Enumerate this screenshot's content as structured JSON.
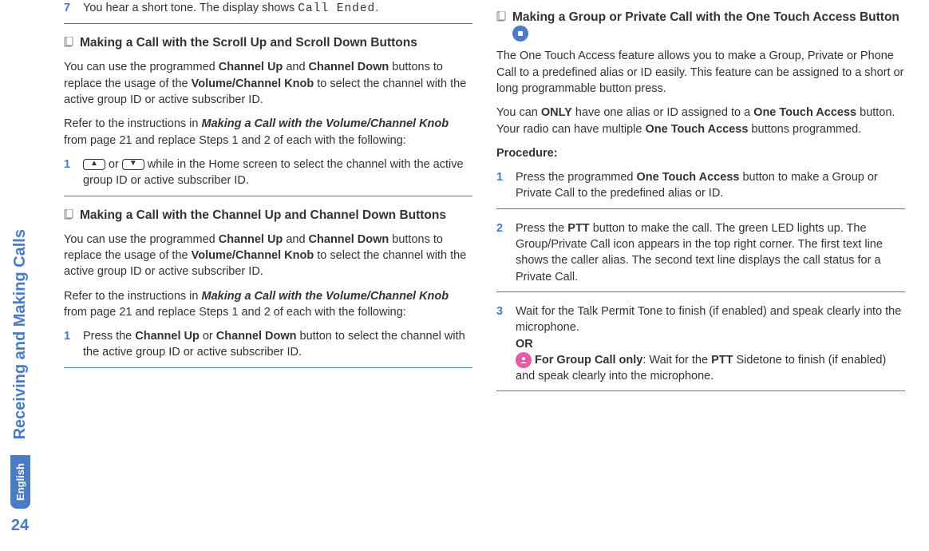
{
  "sidebar": {
    "section_title": "Receiving and Making Calls",
    "language": "English",
    "page_number": "24"
  },
  "left_column": {
    "step7": {
      "num": "7",
      "text_before_code": "You hear a short tone. The display shows ",
      "code": "Call Ended",
      "text_after_code": "."
    },
    "heading_a": "Making a Call with the Scroll Up and Scroll Down Buttons",
    "para_a1_parts": {
      "p1": "You can use the programmed ",
      "b1": "Channel Up",
      "p2": " and ",
      "b2": "Channel Down",
      "p3": " buttons to replace the usage of the ",
      "b3": "Volume/Channel Knob",
      "p4": " to select the channel with the active group ID or active subscriber ID."
    },
    "para_a2_parts": {
      "p1": "Refer to the instructions in ",
      "bi1": "Making a Call with the Volume/Channel Knob",
      "p2": " from page 21 and replace Steps 1 and 2 of each with the following:"
    },
    "step_a1": {
      "num": "1",
      "p1": " or ",
      "p2": " while in the Home screen to select the channel with the active group ID or active subscriber ID."
    },
    "heading_b": "Making a Call with the Channel Up and Channel Down Buttons",
    "para_b1_parts": {
      "p1": "You can use the programmed ",
      "b1": "Channel Up",
      "p2": " and ",
      "b2": "Channel Down",
      "p3": " buttons to replace the usage of the ",
      "b3": "Volume/Channel Knob",
      "p4": " to select the channel with the active group ID or active subscriber ID."
    },
    "para_b2_parts": {
      "p1": "Refer to the instructions in ",
      "bi1": "Making a Call with the Volume/Channel Knob",
      "p2": " from page 21 and replace Steps 1 and 2 of each with the following:"
    },
    "step_b1": {
      "num": "1",
      "p1": "Press the ",
      "b1": "Channel Up",
      "p2": " or ",
      "b2": "Channel Down",
      "p3": " button to select the channel with the active group ID or active subscriber ID."
    }
  },
  "right_column": {
    "heading_c": "Making a Group or Private Call with the One Touch Access Button ",
    "para_c1": "The One Touch Access feature allows you to make a Group, Private or Phone Call to a predefined alias or ID easily. This feature can be assigned to a short or long programmable button press.",
    "para_c2_parts": {
      "p1": "You can ",
      "b1": "ONLY",
      "p2": " have one alias or ID assigned to a ",
      "b2": "One Touch Access",
      "p3": " button. Your radio can have multiple ",
      "b3": "One Touch Access",
      "p4": " buttons programmed."
    },
    "procedure_label": "Procedure:",
    "step_c1": {
      "num": "1",
      "p1": "Press the programmed ",
      "b1": "One Touch Access",
      "p2": " button to make a Group or Private Call to the predefined alias or ID."
    },
    "step_c2": {
      "num": "2",
      "p1": "Press the ",
      "b1": "PTT",
      "p2": " button to make the call. The green LED lights up. The Group/Private Call icon appears in the top right corner. The first text line shows the caller alias. The second text line displays the call status for a Private Call."
    },
    "step_c3": {
      "num": "3",
      "p1": "Wait for the Talk Permit Tone to finish (if enabled) and speak clearly into the microphone.",
      "or_label": "OR",
      "b_group": "For Group Call only",
      "p2": ": Wait for the ",
      "b_ptt": "PTT",
      "p3": " Sidetone to finish (if enabled) and speak clearly into the microphone."
    }
  }
}
